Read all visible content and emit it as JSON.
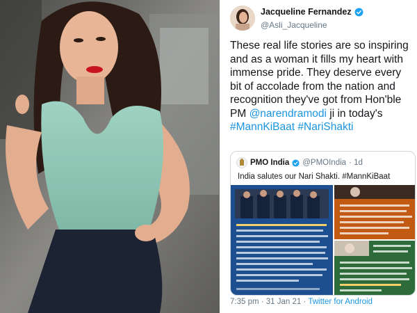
{
  "tweet": {
    "author_name": "Jacqueline Fernandez",
    "author_handle": "@Asli_Jacqueline",
    "text_plain_1": "These real life stories are so inspiring and as a woman it fills my heart with immense pride. They deserve every bit of accolade from the nation and recognition they've got from Hon'ble PM ",
    "mention": "@narendramodi",
    "text_plain_2": " ji in today's ",
    "hashtag_1": "#MannKiBaat",
    "hashtag_2": "#NariShakti",
    "verified_icon": "verified-badge-icon",
    "timestamp": "7:35 pm · 31 Jan 21 · ",
    "source": "Twitter for Android"
  },
  "quoted": {
    "author_name": "PMO India",
    "author_handle": "@PMOIndia",
    "age": "· 1d",
    "text": "India salutes our Nari Shakti. #MannKiBaat"
  },
  "colors": {
    "link": "#1b95e0",
    "text": "#14171a",
    "muted": "#657786",
    "tile_blue": "#1d4e8f",
    "tile_orange": "#c25a13",
    "tile_green": "#2e6b3a"
  }
}
